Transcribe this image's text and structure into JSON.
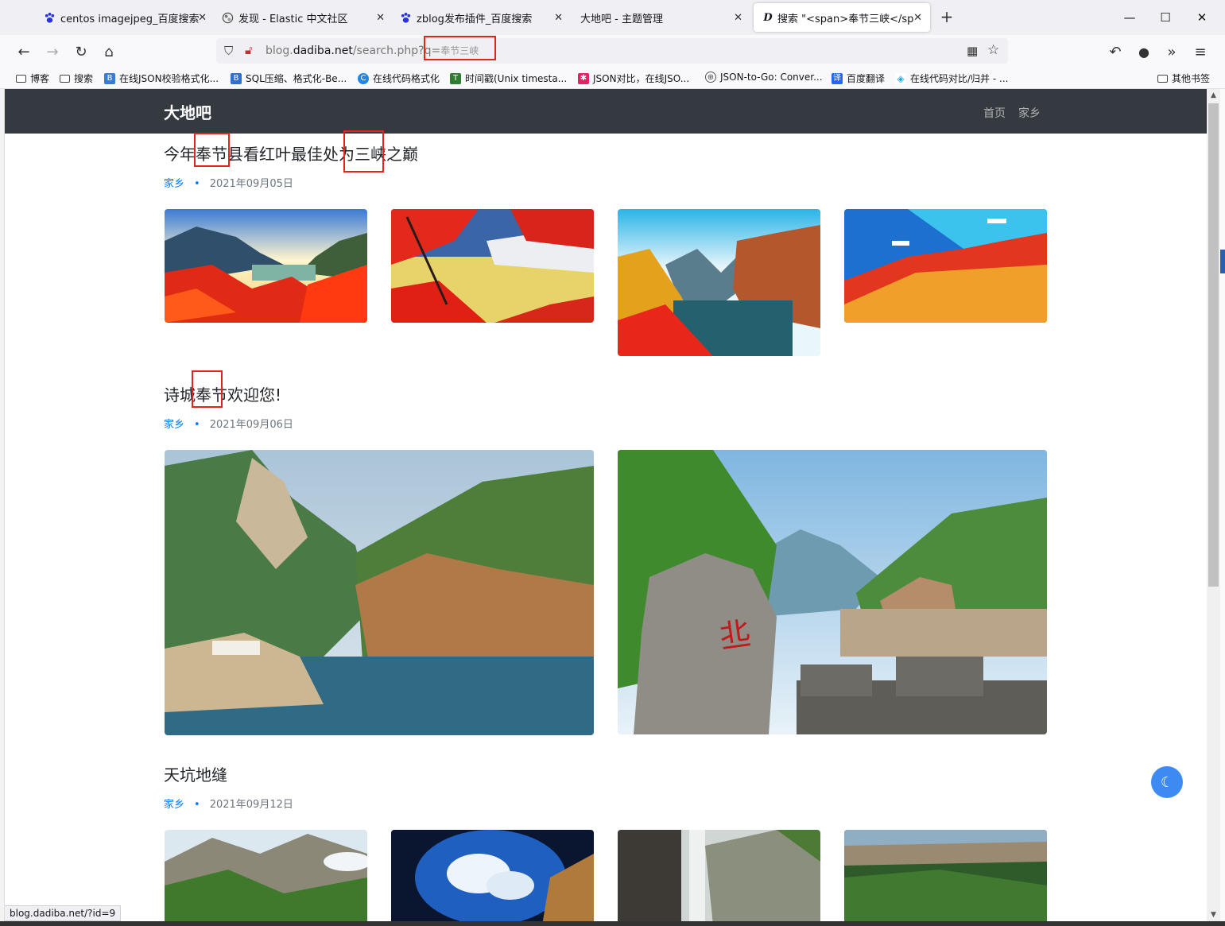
{
  "tabs": [
    {
      "title": "centos imagejpeg_百度搜索",
      "icon": "baidu-paw-icon"
    },
    {
      "title": "发现 - Elastic 中文社区",
      "icon": "elastic-logo-icon"
    },
    {
      "title": "zblog发布插件_百度搜索",
      "icon": "baidu-paw-icon"
    },
    {
      "title": "大地吧 - 主题管理",
      "icon": ""
    },
    {
      "title": "搜索 \"<span>奉节三峡</span>\"",
      "icon": "dadiba-d-logo-icon"
    }
  ],
  "address": {
    "prefix": "blog.",
    "host": "dadiba.net",
    "path": "/search.php?q=",
    "query": "奉节三峡"
  },
  "bookmarks": [
    "博客",
    "搜索",
    "在线JSON校验格式化...",
    "SQL压缩、格式化-Be...",
    "在线代码格式化",
    "时间戳(Unix timesta...",
    "JSON对比，在线JSO...",
    "JSON-to-Go: Conver...",
    "百度翻译",
    "在线代码对比/归并 - ...",
    "其他书签"
  ],
  "site": {
    "brand": "大地吧",
    "nav": [
      "首页",
      "家乡"
    ]
  },
  "posts": [
    {
      "title_parts": [
        "今年",
        "奉节",
        "县看红叶最佳处为",
        "三峡",
        "之巅"
      ],
      "category": "家乡",
      "dot": "•",
      "date": "2021年09月05日"
    },
    {
      "title_parts": [
        "诗城",
        "奉节",
        "欢迎您!"
      ],
      "category": "家乡",
      "dot": "•",
      "date": "2021年09月06日"
    },
    {
      "title": "天坑地缝",
      "category": "家乡",
      "dot": "•",
      "date": "2021年09月12日"
    }
  ],
  "status_url": "blog.dadiba.net/?id=9",
  "colors": {
    "site_nav_bg": "#343a40",
    "link_blue": "#007bff",
    "highlight_box": "#e1251b",
    "fab": "#3d8bf2"
  }
}
